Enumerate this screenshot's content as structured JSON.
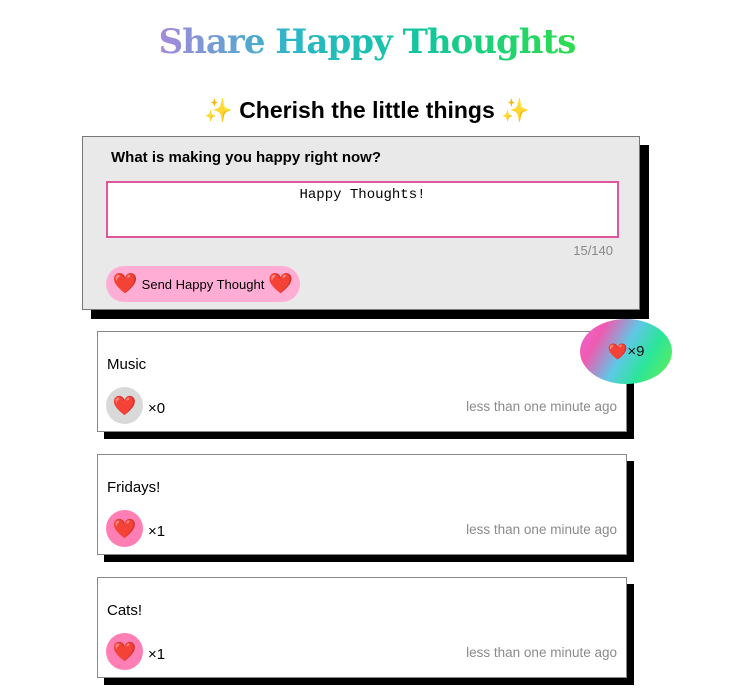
{
  "header": {
    "title": "Share Happy Thoughts",
    "subtitle": "✨ Cherish the little things ✨"
  },
  "composer": {
    "label": "What is making you happy right now?",
    "input_value": "Happy Thoughts!",
    "char_count": "15/140",
    "send_heart_left": "❤️",
    "send_label": "Send Happy Thought",
    "send_heart_right": "❤️"
  },
  "total_likes": {
    "heart": "❤️",
    "count": "×9"
  },
  "thoughts": [
    {
      "text": "Music",
      "heart": "❤️",
      "likes": "×0",
      "liked": false,
      "time": "less than one minute ago"
    },
    {
      "text": "Fridays!",
      "heart": "❤️",
      "likes": "×1",
      "liked": true,
      "time": "less than one minute ago"
    },
    {
      "text": "Cats!",
      "heart": "❤️",
      "likes": "×1",
      "liked": true,
      "time": "less than one minute ago"
    }
  ],
  "colors": {
    "accent_pink": "#ffadd4",
    "liked_pink": "#ff7fb4",
    "unliked_gray": "#d9d9d9",
    "input_border": "#e0569c"
  }
}
